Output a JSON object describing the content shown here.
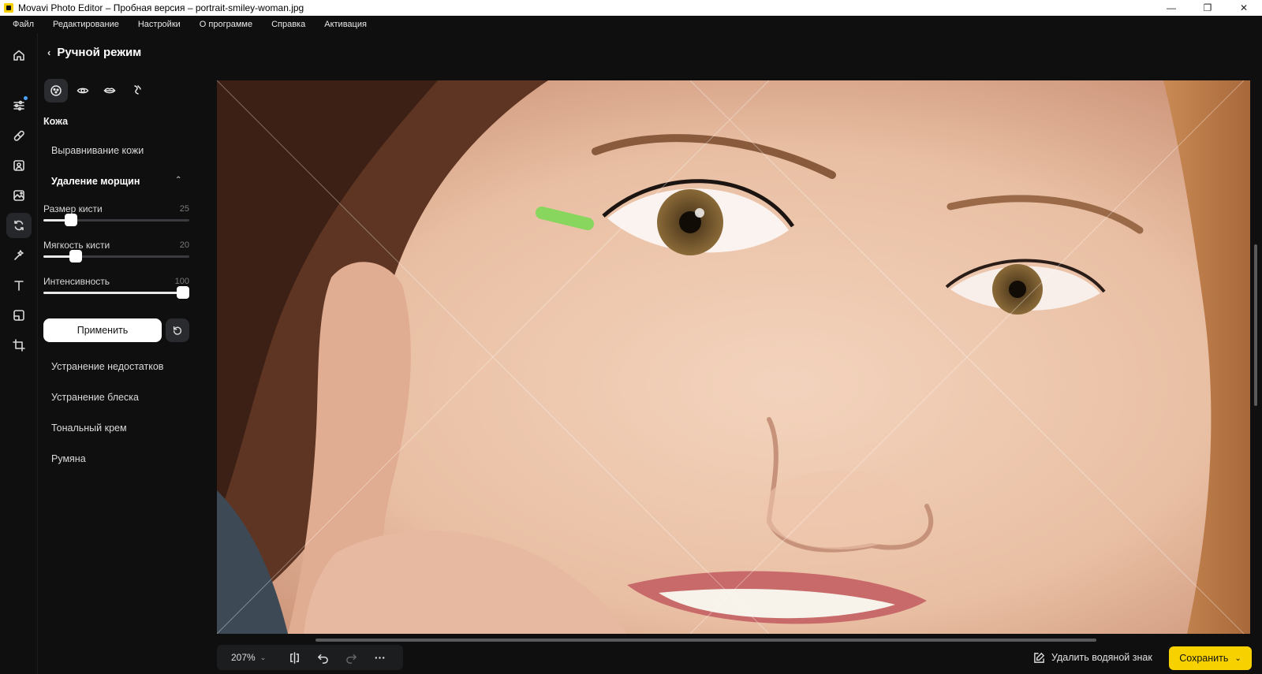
{
  "window": {
    "title": "Movavi Photo Editor – Пробная версия – portrait-smiley-woman.jpg",
    "minimize": "—",
    "maximize": "❐",
    "close": "✕"
  },
  "menu": [
    "Файл",
    "Редактирование",
    "Настройки",
    "О программе",
    "Справка",
    "Активация"
  ],
  "rail": {
    "items": [
      "home-icon",
      "adjust-icon",
      "retouch-icon",
      "portrait-icon",
      "enhance-icon",
      "manual-retouch-icon",
      "magic-icon",
      "text-icon",
      "objects-icon",
      "crop-icon"
    ],
    "active": "manual-retouch-icon",
    "notification_color": "#4aa3ff"
  },
  "panel": {
    "title": "Ручной режим",
    "face_tabs": [
      "skin-icon",
      "eye-icon",
      "lips-icon",
      "hair-icon"
    ],
    "section_title": "Кожа",
    "tools": {
      "smoothing": "Выравнивание кожи",
      "wrinkles": "Удаление морщин",
      "blemishes": "Устранение недостатков",
      "shine": "Устранение блеска",
      "foundation": "Тональный крем",
      "blush": "Румяна"
    },
    "sliders": [
      {
        "label": "Размер кисти",
        "value": "25",
        "fraction": 0.19
      },
      {
        "label": "Мягкость кисти",
        "value": "20",
        "fraction": 0.22
      },
      {
        "label": "Интенсивность",
        "value": "100",
        "fraction": 1.0
      }
    ],
    "apply_label": "Применить"
  },
  "bottom": {
    "zoom": "207%",
    "watermark_label": "Удалить водяной знак",
    "save_label": "Сохранить"
  },
  "colors": {
    "accent": "#f8d200",
    "brush_stroke": "#7ed957"
  }
}
